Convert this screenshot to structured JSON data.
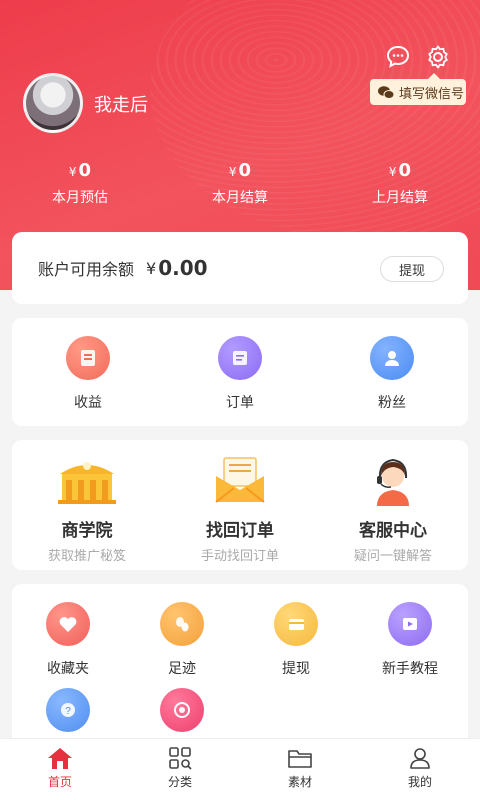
{
  "header": {
    "username": "我走后",
    "wechat_tag": "填写微信号",
    "stats": [
      {
        "currency": "¥",
        "amount": "0",
        "label": "本月预估"
      },
      {
        "currency": "¥",
        "amount": "0",
        "label": "本月结算"
      },
      {
        "currency": "¥",
        "amount": "0",
        "label": "上月结算"
      }
    ]
  },
  "balance": {
    "label": "账户可用余额",
    "currency": "¥",
    "value": "0.00",
    "withdraw_label": "提现"
  },
  "quick": [
    {
      "label": "收益",
      "icon": "income-icon",
      "color": "#f26b5b"
    },
    {
      "label": "订单",
      "icon": "order-icon",
      "color": "#8b6cf5"
    },
    {
      "label": "粉丝",
      "icon": "fans-icon",
      "color": "#4a8cf2"
    }
  ],
  "features": [
    {
      "title": "商学院",
      "subtitle": "获取推广秘笈",
      "icon": "academy-icon"
    },
    {
      "title": "找回订单",
      "subtitle": "手动找回订单",
      "icon": "retrieve-order-icon"
    },
    {
      "title": "客服中心",
      "subtitle": "疑问一键解答",
      "icon": "customer-service-icon"
    }
  ],
  "tools": [
    {
      "label": "收藏夹",
      "icon": "favorites-icon",
      "color": "#f0605a"
    },
    {
      "label": "足迹",
      "icon": "footprint-icon",
      "color": "#f4a03c"
    },
    {
      "label": "提现",
      "icon": "withdraw-icon",
      "color": "#f5b93c"
    },
    {
      "label": "新手教程",
      "icon": "tutorial-icon",
      "color": "#8f6cf2"
    },
    {
      "label": "",
      "icon": "help-icon",
      "color": "#4e8ef0"
    },
    {
      "label": "",
      "icon": "aperture-icon",
      "color": "#ef3f6f"
    }
  ],
  "tabs": [
    {
      "label": "首页",
      "icon": "home-icon",
      "active": true
    },
    {
      "label": "分类",
      "icon": "category-icon",
      "active": false
    },
    {
      "label": "素材",
      "icon": "folder-icon",
      "active": false
    },
    {
      "label": "我的",
      "icon": "profile-icon",
      "active": false
    }
  ],
  "colors": {
    "brand": "#ee3c4b",
    "active_tab": "#e8313f"
  }
}
